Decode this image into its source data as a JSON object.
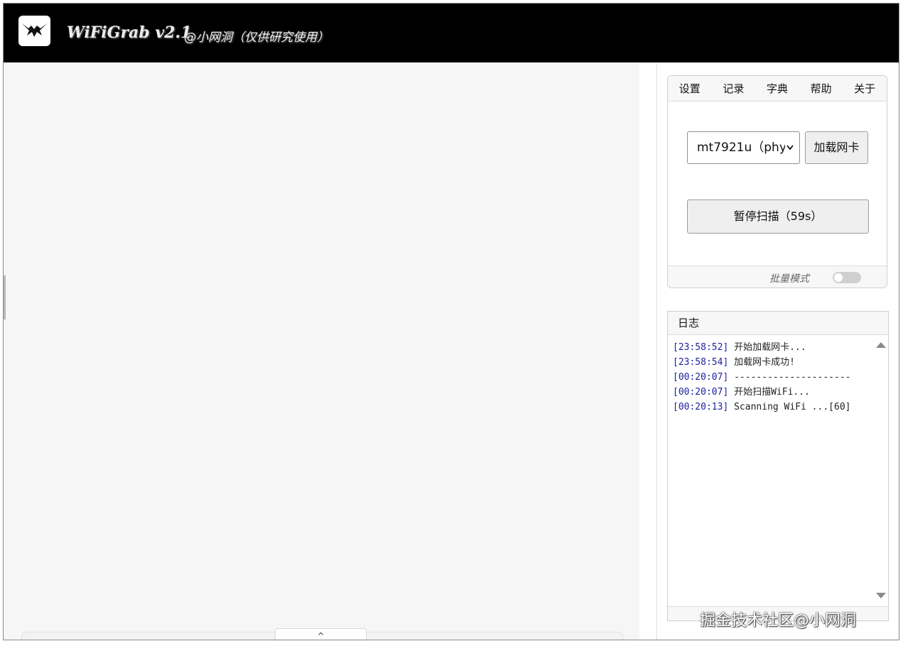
{
  "app": {
    "title": "WiFiGrab v2.1",
    "subtitle": "@小网洞（仅供研究使用）"
  },
  "menu": {
    "items": [
      "设置",
      "记录",
      "字典",
      "帮助",
      "关于"
    ]
  },
  "controls": {
    "nic_selected": "mt7921u（phy",
    "load_button": "加载网卡",
    "scan_button": "暂停扫描（59s）",
    "batch_mode_label": "批量模式",
    "batch_mode_enabled": false
  },
  "log": {
    "title": "日志",
    "entries": [
      {
        "time": "[23:58:52]",
        "msg": " 开始加载网卡..."
      },
      {
        "time": "[23:58:54]",
        "msg": " 加载网卡成功!"
      },
      {
        "time": "[00:20:07]",
        "msg": " ---------------------"
      },
      {
        "time": "[00:20:07]",
        "msg": " 开始扫描WiFi..."
      },
      {
        "time": "[00:20:13]",
        "msg": " Scanning WiFi ...[60]"
      }
    ]
  },
  "bottom_toggle": "^",
  "watermark": "掘金技术社区@小网洞",
  "icons": {
    "logo": "bat-logo-icon",
    "select_arrow": "chevron-down-icon",
    "scroll_up": "scroll-up-icon",
    "scroll_down": "scroll-down-icon"
  }
}
